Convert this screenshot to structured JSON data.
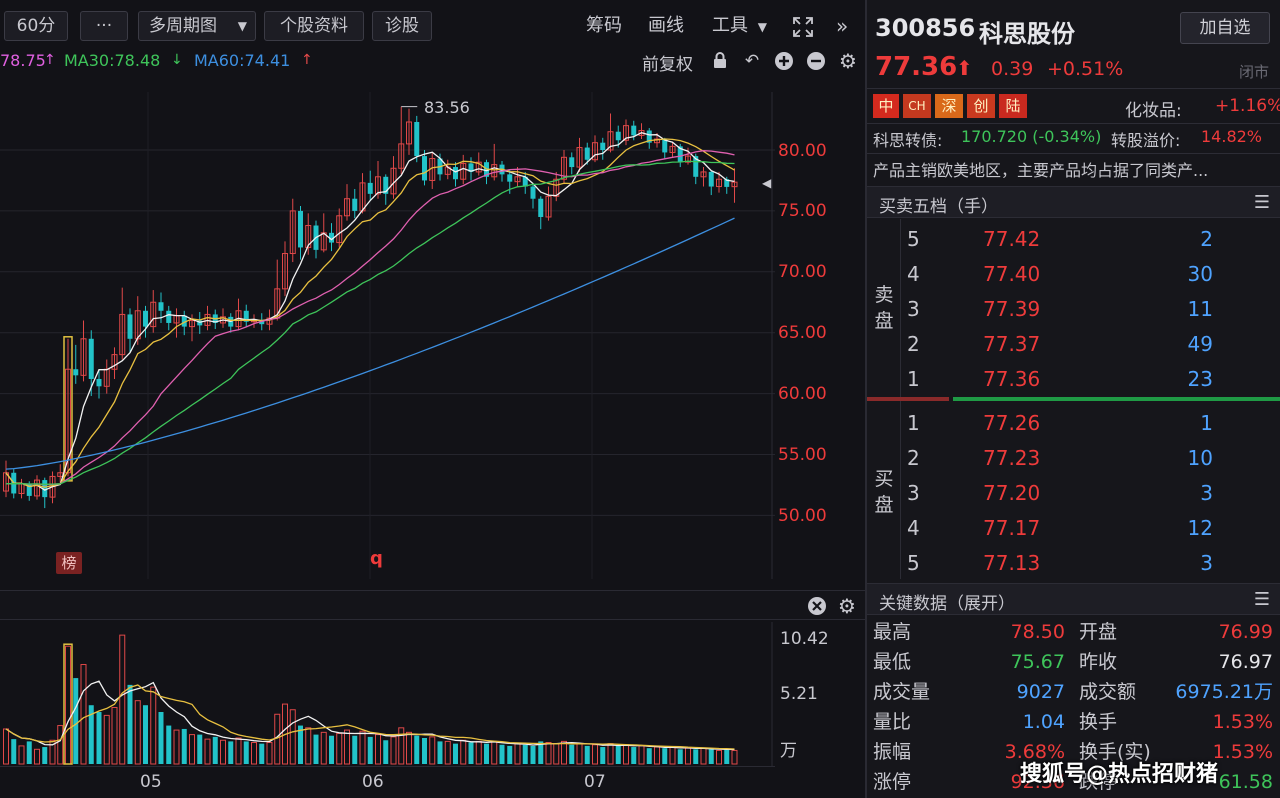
{
  "toolbar": {
    "period": "60分",
    "more": "···",
    "multi_period": "多周期图",
    "stock_info": "个股资料",
    "diagnosis": "诊股",
    "chips": "筹码",
    "draw": "画线",
    "tools": "工具",
    "expand_icon": "expand-icon",
    "collapse_icon": "chevrons-right-icon"
  },
  "indicators": {
    "ma_partial": "78.75",
    "ma30": "MA30:78.48",
    "ma60": "MA60:74.41",
    "adjust": "前复权",
    "colors": {
      "ma_partial": "#e060e0",
      "ma30": "#3ec45a",
      "ma60": "#3d8fe0"
    }
  },
  "chart_annotations": {
    "high_label": "83.56",
    "tag_rank": "榜",
    "tag_q": "q"
  },
  "price_axis": [
    "80.00",
    "75.00",
    "70.00",
    "65.00",
    "60.00",
    "55.00",
    "50.00"
  ],
  "volume_axis": [
    "10.42",
    "5.21",
    "万"
  ],
  "x_axis": [
    "05",
    "06",
    "07"
  ],
  "stock": {
    "code": "300856",
    "name": "科思股份",
    "watch_button": "加自选",
    "price": "77.36",
    "change": "0.39",
    "change_pct": "+0.51%",
    "status": "闭市",
    "tags": [
      "中",
      "CH",
      "深",
      "创",
      "陆"
    ],
    "sector_label": "化妆品:",
    "sector_change": "+1.16%",
    "bond_label": "科思转债:",
    "bond_value": "170.720 (-0.34%)",
    "premium_label": "转股溢价:",
    "premium_value": "14.82%",
    "description": "产品主销欧美地区，主要产品均占据了同类产..."
  },
  "order_book": {
    "title": "买卖五档（手）",
    "sell_label": [
      "卖",
      "盘"
    ],
    "buy_label": [
      "买",
      "盘"
    ],
    "sell": [
      {
        "level": "5",
        "price": "77.42",
        "vol": "2"
      },
      {
        "level": "4",
        "price": "77.40",
        "vol": "30"
      },
      {
        "level": "3",
        "price": "77.39",
        "vol": "11"
      },
      {
        "level": "2",
        "price": "77.37",
        "vol": "49"
      },
      {
        "level": "1",
        "price": "77.36",
        "vol": "23"
      }
    ],
    "buy": [
      {
        "level": "1",
        "price": "77.26",
        "vol": "1"
      },
      {
        "level": "2",
        "price": "77.23",
        "vol": "10"
      },
      {
        "level": "3",
        "price": "77.20",
        "vol": "3"
      },
      {
        "level": "4",
        "price": "77.17",
        "vol": "12"
      },
      {
        "level": "5",
        "price": "77.13",
        "vol": "3"
      }
    ]
  },
  "key_data": {
    "title": "关键数据（展开）",
    "rows": [
      {
        "l1": "最高",
        "v1": "78.50",
        "l2": "开盘",
        "v2": "76.99"
      },
      {
        "l1": "最低",
        "v1": "75.67",
        "l2": "昨收",
        "v2": "76.97"
      },
      {
        "l1": "成交量",
        "v1": "9027",
        "l2": "成交额",
        "v2": "6975.21万"
      },
      {
        "l1": "量比",
        "v1": "1.04",
        "l2": "换手",
        "v2": "1.53%"
      },
      {
        "l1": "振幅",
        "v1": "3.68%",
        "l2": "换手(实)",
        "v2": "1.53%"
      },
      {
        "l1": "涨停",
        "v1": "92.36",
        "l2": "跌停",
        "v2": "61.58"
      }
    ]
  },
  "watermark": "搜狐号@热点招财猪",
  "chart_data": {
    "type": "candlestick",
    "interval": "60分",
    "price_axis": [
      50,
      55,
      60,
      65,
      70,
      75,
      80
    ],
    "ylim": [
      46.5,
      84.5
    ],
    "volume_ylim": [
      0,
      11.5
    ],
    "volume_unit": "万",
    "x_ticks": [
      "05",
      "06",
      "07"
    ],
    "annotations": {
      "high": 83.56
    },
    "series": [
      {
        "name": "MA30",
        "last": 78.48
      },
      {
        "name": "MA60",
        "last": 74.41
      }
    ],
    "candles": [
      [
        52.0,
        53.5,
        54.5,
        51.5
      ],
      [
        53.5,
        51.8,
        53.8,
        51.4
      ],
      [
        51.8,
        52.6,
        53.0,
        51.4
      ],
      [
        52.6,
        51.6,
        52.8,
        51.2
      ],
      [
        51.6,
        52.9,
        53.3,
        51.3
      ],
      [
        52.9,
        51.5,
        53.1,
        50.6
      ],
      [
        51.5,
        53.2,
        53.6,
        51.0
      ],
      [
        53.2,
        53.5,
        54.2,
        52.6
      ],
      [
        53.5,
        62.0,
        64.5,
        53.2
      ],
      [
        62.0,
        61.5,
        64.0,
        60.8
      ],
      [
        61.5,
        64.5,
        66.0,
        61.0
      ],
      [
        64.5,
        61.2,
        65.2,
        59.8
      ],
      [
        61.2,
        60.6,
        62.0,
        59.6
      ],
      [
        60.6,
        62.0,
        62.8,
        60.0
      ],
      [
        62.0,
        63.2,
        63.8,
        61.2
      ],
      [
        63.2,
        66.5,
        68.7,
        62.8
      ],
      [
        66.5,
        64.5,
        67.0,
        63.4
      ],
      [
        64.5,
        66.8,
        68.0,
        64.0
      ],
      [
        66.8,
        65.5,
        67.2,
        64.6
      ],
      [
        65.5,
        67.5,
        68.5,
        65.0
      ],
      [
        67.5,
        66.8,
        68.3,
        65.8
      ],
      [
        66.8,
        65.8,
        67.2,
        65.2
      ],
      [
        65.8,
        66.4,
        67.0,
        64.6
      ],
      [
        66.4,
        65.5,
        66.8,
        64.8
      ],
      [
        65.5,
        66.0,
        66.5,
        64.3
      ],
      [
        66.0,
        65.6,
        66.7,
        64.9
      ],
      [
        65.6,
        66.5,
        67.2,
        65.2
      ],
      [
        66.5,
        65.8,
        66.9,
        65.3
      ],
      [
        65.8,
        66.3,
        67.0,
        65.4
      ],
      [
        66.3,
        65.5,
        66.6,
        65.0
      ],
      [
        65.5,
        66.8,
        67.8,
        65.2
      ],
      [
        66.8,
        65.9,
        67.3,
        65.5
      ],
      [
        65.9,
        66.0,
        66.5,
        65.4
      ],
      [
        66.0,
        65.7,
        66.6,
        65.2
      ],
      [
        65.7,
        66.2,
        66.9,
        65.2
      ],
      [
        66.2,
        68.6,
        71.0,
        66.0
      ],
      [
        68.6,
        71.5,
        72.5,
        68.0
      ],
      [
        71.5,
        75.0,
        76.0,
        70.8
      ],
      [
        75.0,
        72.0,
        75.4,
        71.0
      ],
      [
        72.0,
        73.8,
        74.8,
        71.4
      ],
      [
        73.8,
        71.8,
        74.2,
        71.1
      ],
      [
        71.8,
        73.2,
        74.8,
        71.6
      ],
      [
        73.2,
        72.4,
        74.0,
        71.7
      ],
      [
        72.4,
        74.6,
        75.2,
        72.0
      ],
      [
        74.6,
        76.0,
        77.2,
        74.2
      ],
      [
        76.0,
        75.0,
        76.8,
        74.4
      ],
      [
        75.0,
        77.3,
        78.1,
        74.8
      ],
      [
        77.3,
        76.4,
        78.3,
        75.8
      ],
      [
        76.4,
        77.8,
        79.1,
        76.0
      ],
      [
        77.8,
        76.4,
        78.0,
        75.5
      ],
      [
        76.4,
        78.5,
        79.5,
        76.0
      ],
      [
        78.5,
        80.5,
        83.56,
        78.0
      ],
      [
        80.5,
        82.3,
        83.4,
        79.6
      ],
      [
        82.3,
        79.5,
        82.8,
        79.0
      ],
      [
        79.5,
        77.5,
        80.0,
        77.1
      ],
      [
        77.5,
        79.3,
        79.8,
        76.8
      ],
      [
        79.3,
        78.0,
        79.7,
        77.5
      ],
      [
        78.0,
        78.6,
        79.2,
        77.6
      ],
      [
        78.6,
        77.6,
        79.0,
        77.0
      ],
      [
        77.6,
        78.9,
        79.6,
        77.2
      ],
      [
        78.9,
        78.2,
        79.4,
        77.5
      ],
      [
        78.2,
        79.0,
        79.8,
        77.9
      ],
      [
        79.0,
        77.8,
        79.2,
        77.2
      ],
      [
        77.8,
        78.8,
        80.5,
        77.5
      ],
      [
        78.8,
        78.0,
        79.1,
        77.4
      ],
      [
        78.0,
        77.4,
        78.4,
        76.4
      ],
      [
        77.4,
        77.8,
        78.6,
        77.0
      ],
      [
        77.8,
        77.0,
        78.2,
        76.4
      ],
      [
        77.0,
        76.0,
        77.3,
        75.2
      ],
      [
        76.0,
        74.5,
        76.2,
        73.5
      ],
      [
        74.5,
        76.2,
        77.0,
        74.2
      ],
      [
        76.2,
        77.6,
        78.2,
        75.8
      ],
      [
        77.6,
        79.4,
        80.0,
        77.2
      ],
      [
        79.4,
        78.6,
        79.8,
        78.0
      ],
      [
        78.6,
        80.2,
        81.0,
        78.2
      ],
      [
        80.2,
        79.2,
        80.6,
        78.8
      ],
      [
        79.2,
        80.6,
        81.2,
        79.0
      ],
      [
        80.6,
        80.0,
        81.0,
        79.2
      ],
      [
        80.0,
        81.5,
        83.0,
        79.8
      ],
      [
        81.5,
        80.8,
        82.0,
        80.2
      ],
      [
        80.8,
        82.0,
        82.5,
        80.4
      ],
      [
        82.0,
        81.2,
        82.4,
        80.8
      ],
      [
        81.2,
        81.6,
        82.2,
        80.9
      ],
      [
        81.6,
        80.6,
        81.8,
        80.1
      ],
      [
        80.6,
        80.9,
        81.4,
        80.2
      ],
      [
        80.9,
        79.8,
        81.0,
        79.3
      ],
      [
        79.8,
        80.3,
        80.7,
        79.4
      ],
      [
        80.3,
        79.0,
        80.5,
        78.6
      ],
      [
        79.0,
        79.5,
        80.2,
        78.8
      ],
      [
        79.5,
        77.8,
        79.7,
        77.2
      ],
      [
        77.8,
        78.2,
        78.6,
        77.0
      ],
      [
        78.2,
        77.0,
        78.3,
        76.3
      ],
      [
        77.0,
        77.6,
        78.2,
        76.5
      ],
      [
        77.6,
        76.97,
        77.8,
        76.4
      ],
      [
        76.99,
        77.36,
        78.5,
        75.67
      ]
    ],
    "volumes": [
      3.1,
      2.2,
      1.6,
      2.0,
      1.3,
      1.5,
      2.1,
      3.4,
      10.42,
      7.6,
      8.8,
      5.2,
      4.6,
      4.3,
      5.0,
      11.4,
      7.0,
      5.6,
      5.2,
      6.8,
      4.6,
      3.4,
      3.0,
      3.1,
      2.6,
      2.6,
      2.2,
      2.4,
      2.1,
      2.0,
      2.3,
      2.0,
      1.9,
      1.8,
      1.9,
      4.4,
      5.3,
      4.8,
      3.4,
      3.2,
      2.6,
      2.8,
      2.5,
      2.7,
      3.0,
      2.5,
      2.9,
      2.4,
      2.6,
      2.1,
      2.4,
      3.2,
      2.8,
      2.5,
      2.3,
      2.4,
      2.0,
      2.0,
      1.8,
      2.1,
      1.9,
      2.0,
      1.8,
      2.0,
      1.7,
      1.6,
      1.8,
      1.7,
      1.6,
      2.0,
      1.9,
      1.8,
      2.0,
      1.7,
      1.8,
      1.6,
      1.7,
      1.5,
      1.8,
      1.6,
      1.7,
      1.5,
      1.6,
      1.4,
      1.5,
      1.4,
      1.5,
      1.3,
      1.4,
      1.3,
      1.4,
      1.3,
      1.2,
      1.3,
      1.2
    ]
  }
}
